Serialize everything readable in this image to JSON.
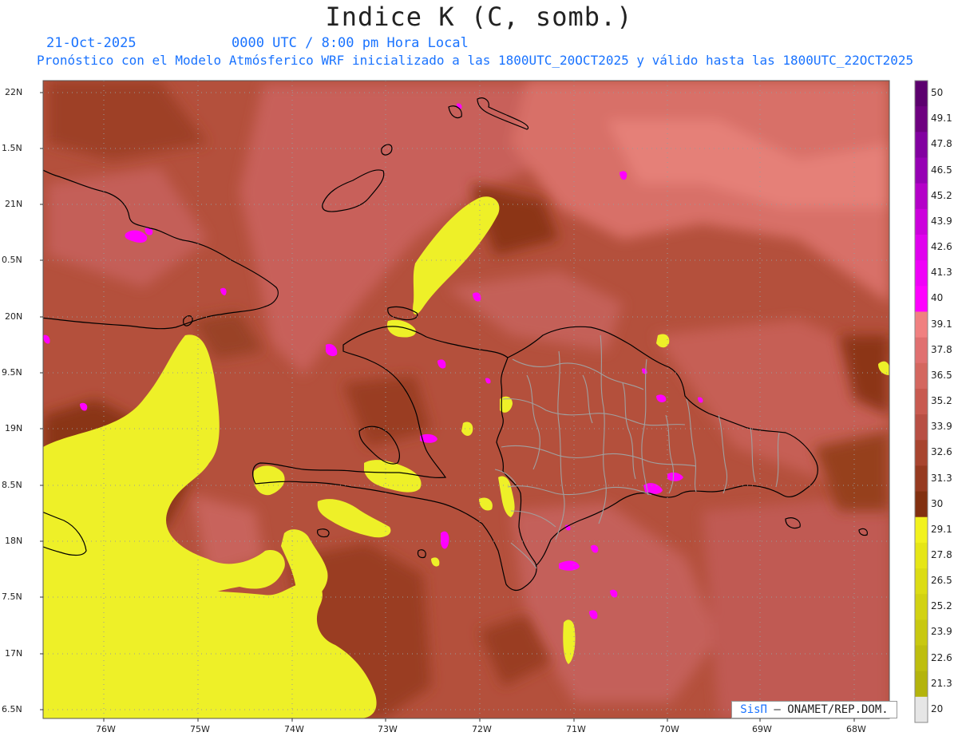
{
  "title": "Indice K (C, somb.)",
  "date_label": "21-Oct-2025",
  "time_label": "0000 UTC / 8:00 pm Hora Local",
  "forecast_text": "Pronóstico con el Modelo Atmósferico WRF inicializado a las 1800UTC_20OCT2025 y válido hasta las  1800UTC_22OCT2025",
  "credit": {
    "logo": "SisΠ",
    "org": "– ONAMET/REP.DOM."
  },
  "lat_labels": [
    "22N",
    "1.5N",
    "21N",
    "0.5N",
    "20N",
    "9.5N",
    "19N",
    "8.5N",
    "18N",
    "7.5N",
    "17N",
    "6.5N"
  ],
  "lon_labels": [
    "76W",
    "75W",
    "74W",
    "73W",
    "72W",
    "71W",
    "70W",
    "69W",
    "68W"
  ],
  "colorbar": {
    "labels": [
      "50",
      "49.1",
      "47.8",
      "46.5",
      "45.2",
      "43.9",
      "42.6",
      "41.3",
      "40",
      "39.1",
      "37.8",
      "36.5",
      "35.2",
      "33.9",
      "32.6",
      "31.3",
      "30",
      "29.1",
      "27.8",
      "26.5",
      "25.2",
      "23.9",
      "22.6",
      "21.3",
      "20"
    ],
    "colors": [
      "#5c006e",
      "#6e0080",
      "#8200a0",
      "#9600b4",
      "#b400c8",
      "#cc00dc",
      "#e000ee",
      "#f000f8",
      "#ff00ff",
      "#f08080",
      "#e07070",
      "#d4675f",
      "#c85a50",
      "#b84f44",
      "#a8452f",
      "#963a20",
      "#823010",
      "#f2f21e",
      "#e6e616",
      "#dcdc14",
      "#d2d212",
      "#c8c810",
      "#bebe0e",
      "#b4b40c",
      "#e6e6e6"
    ]
  },
  "colors": {
    "base": "#b4503c",
    "light": "#d06860",
    "dark": "#8a3418",
    "yellow": "#eef028",
    "magenta": "#ff00ff",
    "coast": "#000000",
    "provinces": "#a0a0a0"
  }
}
